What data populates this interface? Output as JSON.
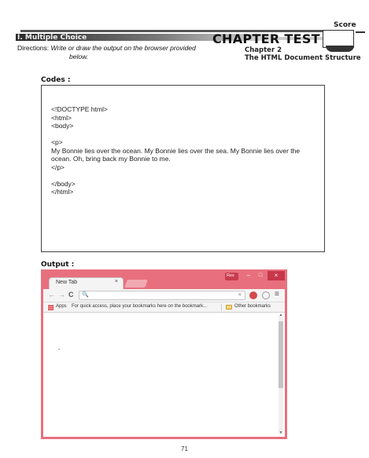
{
  "header": {
    "score_label": "Score",
    "section_title": "I. Multiple Choice",
    "chapter_test": "CHAPTER TEST",
    "chapter_number": "Chapter 2",
    "chapter_title": "The HTML Document Structure"
  },
  "directions": {
    "label": "Directions:",
    "text_line1": "Write or draw the output on the browser provided",
    "text_line2": "below."
  },
  "codes": {
    "label": "Codes :",
    "lines": {
      "l1": "<!DOCTYPE html>",
      "l2": "<html>",
      "l3": "<body>",
      "l4": "<p>",
      "l5": "My Bonnie lies over the ocean. My Bonnie lies over the sea. My Bonnie lies over the ocean. Oh, bring back my Bonnie to me.",
      "l6": "</p>",
      "l7": "</body>",
      "l8": "</html>"
    }
  },
  "output": {
    "label": "Output :"
  },
  "browser": {
    "tab_label": "New Tab",
    "tab_close": "×",
    "user_badge": "Rex",
    "win_min": "–",
    "win_max": "□",
    "win_close": "×",
    "nav_back": "←",
    "nav_forward": "→",
    "nav_reload": "C",
    "search_glyph": "🔍",
    "star_glyph": "★",
    "menu_glyph": "≡",
    "apps_label": "Apps",
    "bookmarks_hint": "For quick access, place your bookmarks here on the bookmark...",
    "other_bookmarks": "Other bookmarks",
    "scroll_up": "▲",
    "scroll_down": "▼",
    "accent_color": "#e8707e"
  },
  "footer": {
    "page_number": "71"
  }
}
